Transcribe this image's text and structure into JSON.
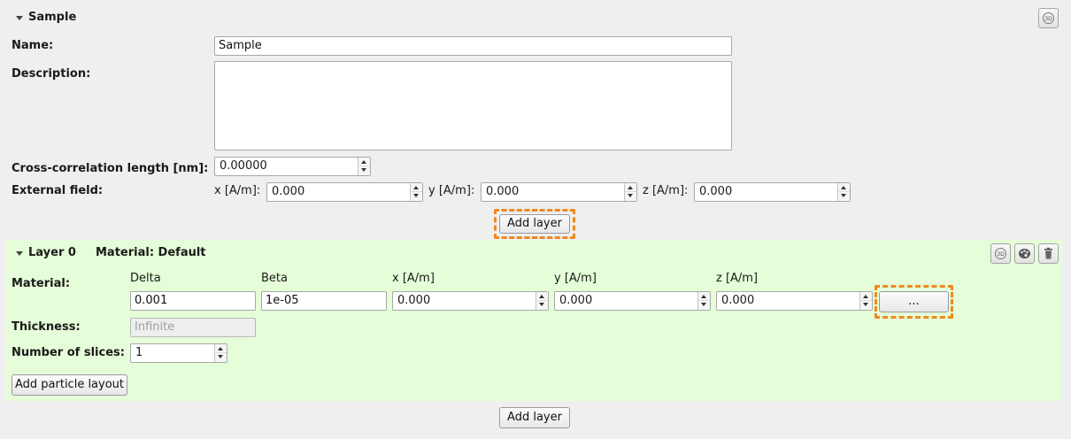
{
  "sample": {
    "title": "Sample",
    "name_label": "Name:",
    "name_value": "Sample",
    "description_label": "Description:",
    "description_value": "",
    "crosscorr_label": "Cross-correlation length [nm]:",
    "crosscorr_value": "0.00000",
    "external_field_label": "External field:",
    "x_label": "x [A/m]:",
    "x_value": "0.000",
    "y_label": "y [A/m]:",
    "y_value": "0.000",
    "z_label": "z [A/m]:",
    "z_value": "0.000",
    "add_layer_label": "Add layer"
  },
  "layer0": {
    "title": "Layer 0",
    "material_title": "Material: Default",
    "material_label": "Material:",
    "columns": [
      "Delta",
      "Beta",
      "x [A/m]",
      "y [A/m]",
      "z [A/m]"
    ],
    "delta_value": "0.001",
    "beta_value": "1e-05",
    "x_value": "0.000",
    "y_value": "0.000",
    "z_value": "0.000",
    "more_button_label": "...",
    "thickness_label": "Thickness:",
    "thickness_placeholder": "Infinite",
    "slices_label": "Number of slices:",
    "slices_value": "1",
    "add_particle_layout_label": "Add particle layout"
  },
  "footer": {
    "add_layer_label": "Add layer"
  },
  "colors": {
    "background": "#efefef",
    "layer_background": "#e5fdd8",
    "highlight": "#f0891e"
  },
  "icons": {
    "sample_3d": "3d-view-icon",
    "layer_3d": "3d-view-icon",
    "layer_material": "material-palette-icon",
    "layer_delete": "trash-icon"
  }
}
